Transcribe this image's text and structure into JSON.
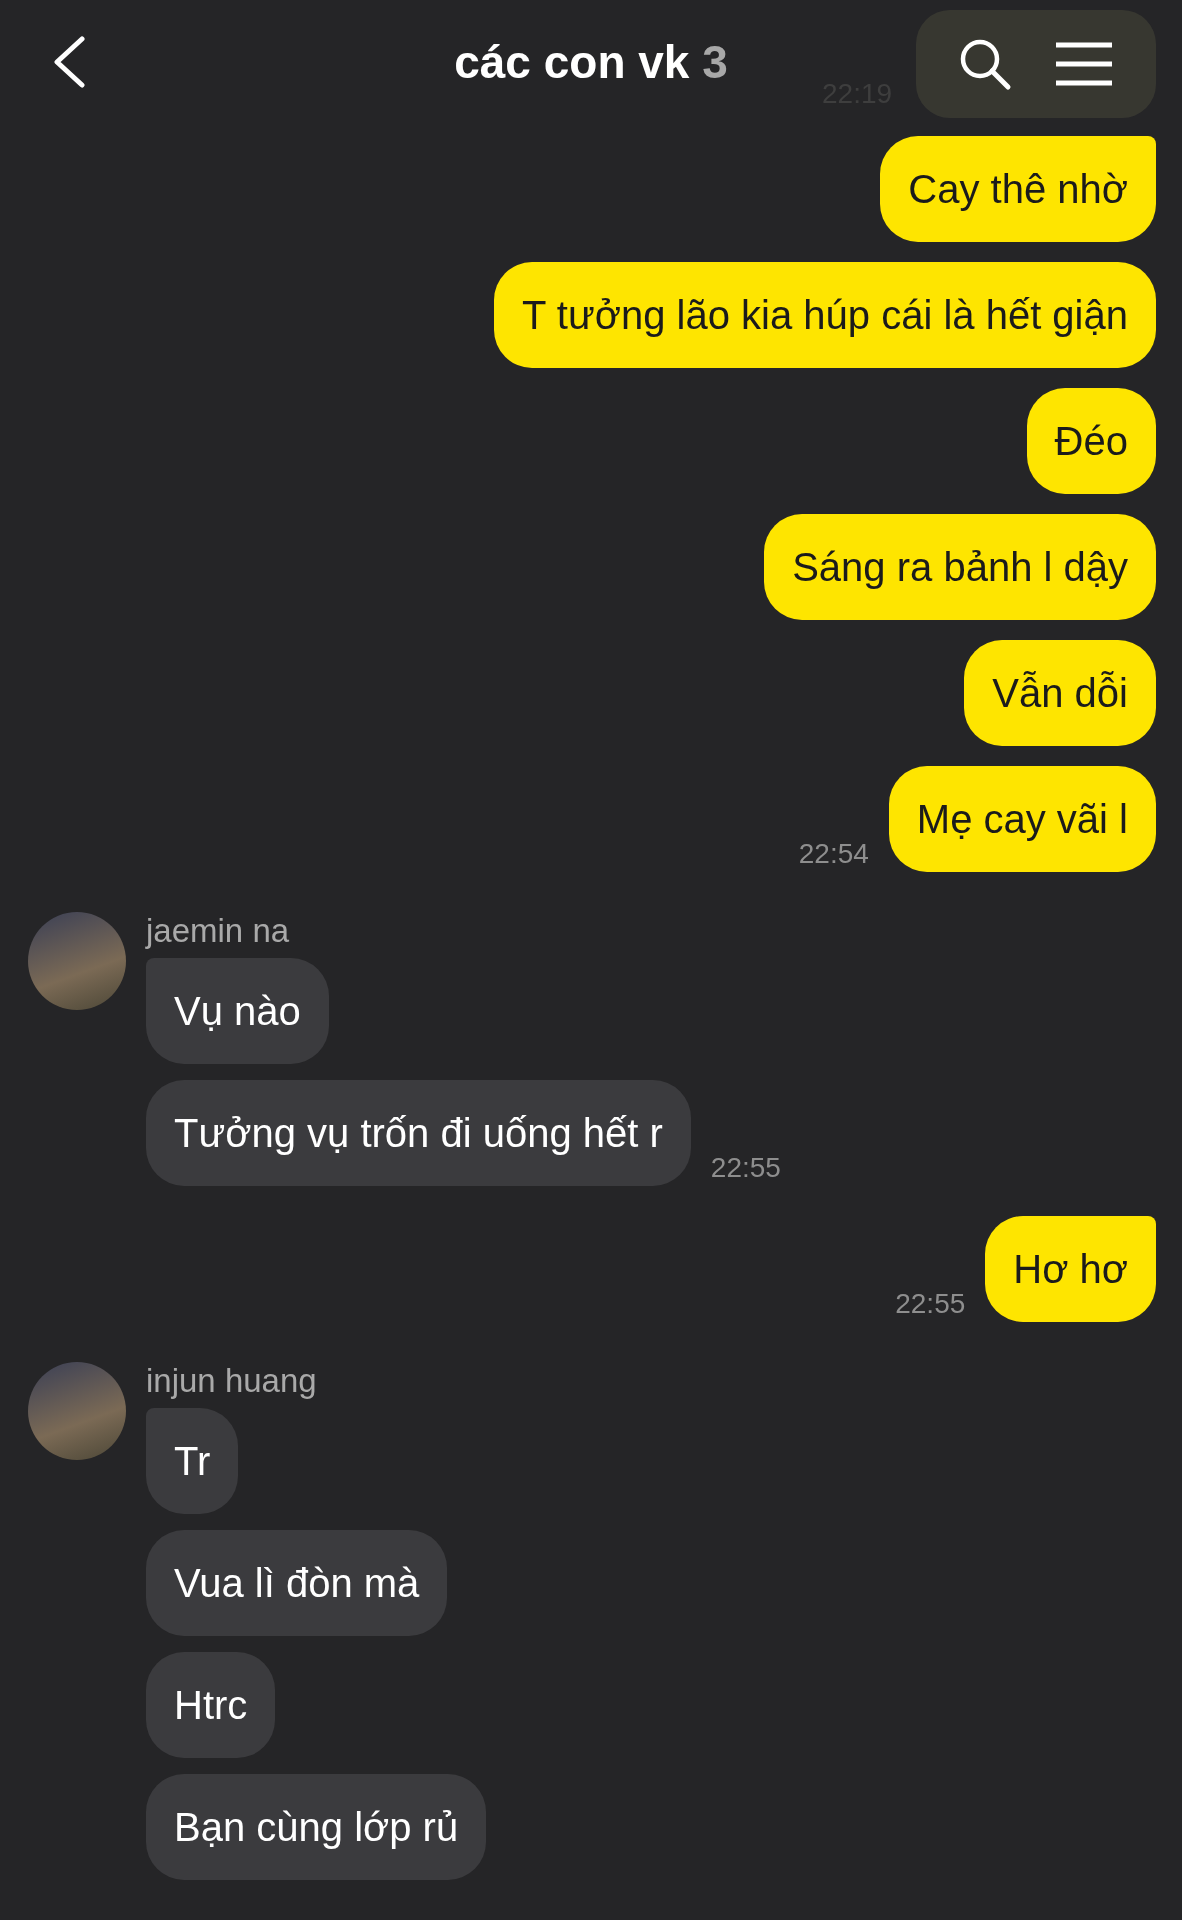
{
  "header": {
    "title": "các con vk",
    "member_count": "3",
    "faded_time": "22:19"
  },
  "groups": [
    {
      "kind": "sent",
      "messages": [
        "Cay thê nhờ",
        "T tưởng lão kia húp cái là hết giận",
        "Đéo",
        "Sáng ra bảnh l dậy",
        "Vẫn dỗi",
        "Mẹ cay vãi l"
      ],
      "time": "22:54"
    },
    {
      "kind": "received",
      "sender": "jaemin na",
      "messages": [
        "Vụ nào",
        "Tưởng vụ trốn đi uống hết r"
      ],
      "time": "22:55"
    },
    {
      "kind": "sent",
      "messages": [
        "Hơ hơ"
      ],
      "time": "22:55"
    },
    {
      "kind": "received",
      "sender": "injun huang",
      "messages": [
        "Tr",
        "Vua lì đòn mà",
        "Htrc",
        "Bạn cùng lớp rủ"
      ]
    }
  ]
}
